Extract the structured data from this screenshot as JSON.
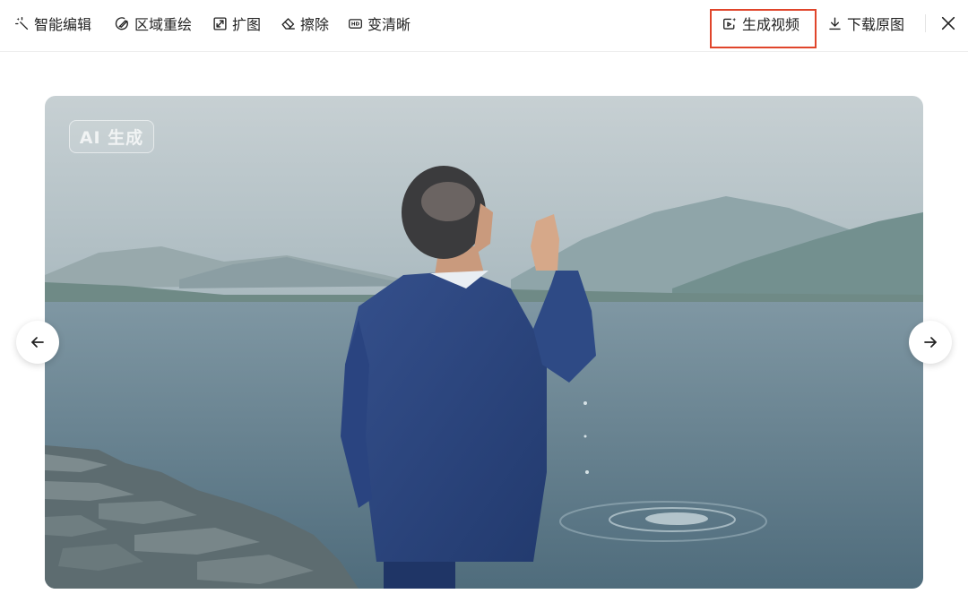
{
  "toolbar": {
    "tools": [
      {
        "label": "智能编辑",
        "icon": "magic-wand-icon"
      },
      {
        "label": "区域重绘",
        "icon": "brush-circle-icon"
      },
      {
        "label": "扩图",
        "icon": "expand-icon"
      },
      {
        "label": "擦除",
        "icon": "eraser-icon"
      },
      {
        "label": "变清晰",
        "icon": "hd-icon"
      }
    ],
    "generate_video_label": "生成视频",
    "generate_video_icon": "video-sparkle-icon",
    "download_label": "下载原图",
    "download_icon": "download-icon",
    "close_icon": "close-icon",
    "highlight_color": "#e0452b"
  },
  "image": {
    "badge": "AI 生成",
    "description_icon": "photo"
  },
  "navigation": {
    "prev_icon": "arrow-left-icon",
    "next_icon": "arrow-right-icon"
  }
}
